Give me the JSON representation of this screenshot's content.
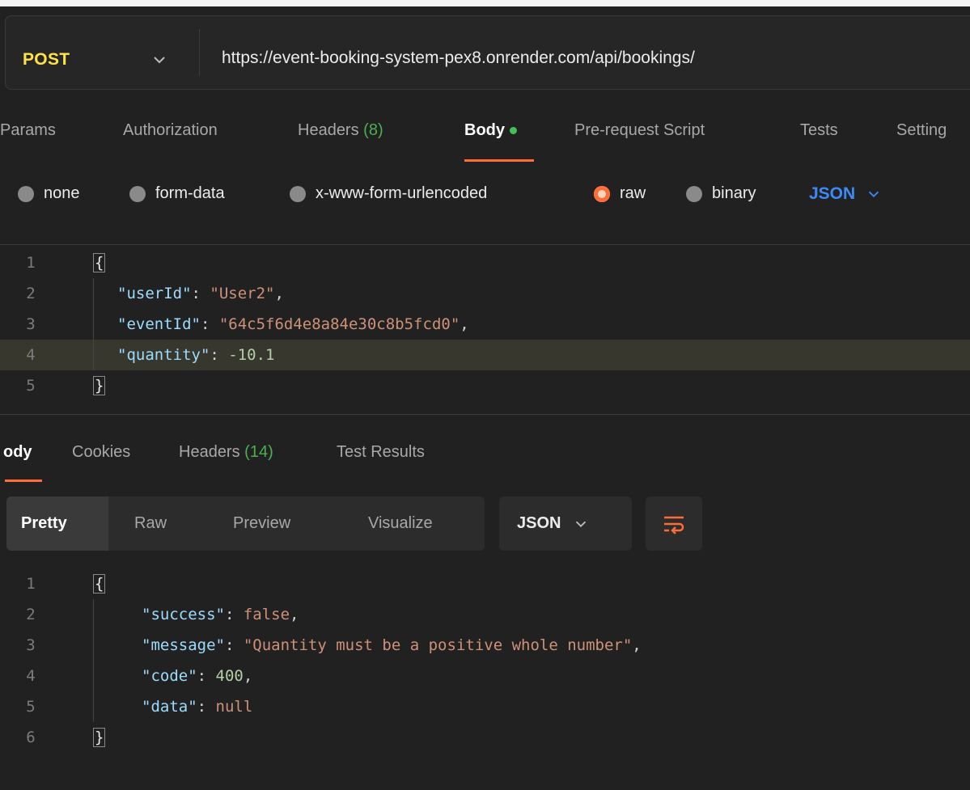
{
  "request": {
    "method": "POST",
    "url": "https://event-booking-system-pex8.onrender.com/api/bookings/"
  },
  "request_tabs": {
    "params": "Params",
    "authorization": "Authorization",
    "headers": "Headers",
    "headers_count": "(8)",
    "body": "Body",
    "prerequest": "Pre-request Script",
    "tests": "Tests",
    "settings": "Setting"
  },
  "body_types": {
    "none": "none",
    "form_data": "form-data",
    "urlencoded": "x-www-form-urlencoded",
    "raw": "raw",
    "binary": "binary",
    "language": "JSON",
    "selected": "raw"
  },
  "request_body": {
    "line_numbers": [
      "1",
      "2",
      "3",
      "4",
      "5"
    ],
    "open_brace": "{",
    "close_brace": "}",
    "userId_key": "\"userId\"",
    "userId_value": "\"User2\"",
    "eventId_key": "\"eventId\"",
    "eventId_value": "\"64c5f6d4e8a84e30c8b5fcd0\"",
    "quantity_key": "\"quantity\"",
    "quantity_value": "-10.1"
  },
  "response_tabs": {
    "body": "ody",
    "cookies": "Cookies",
    "headers": "Headers",
    "headers_count": "(14)",
    "test_results": "Test Results"
  },
  "response_view": {
    "pretty": "Pretty",
    "raw": "Raw",
    "preview": "Preview",
    "visualize": "Visualize",
    "format": "JSON"
  },
  "response_body": {
    "line_numbers": [
      "1",
      "2",
      "3",
      "4",
      "5",
      "6"
    ],
    "open_brace": "{",
    "close_brace": "}",
    "success_key": "\"success\"",
    "success_value": "false",
    "message_key": "\"message\"",
    "message_value": "\"Quantity must be a positive whole number\"",
    "code_key": "\"code\"",
    "code_value": "400",
    "data_key": "\"data\"",
    "data_value": "null"
  },
  "colors": {
    "method": "#ffe24a",
    "accent": "#ff6c37",
    "json_label": "#3d8af7",
    "count": "#4caf50"
  }
}
